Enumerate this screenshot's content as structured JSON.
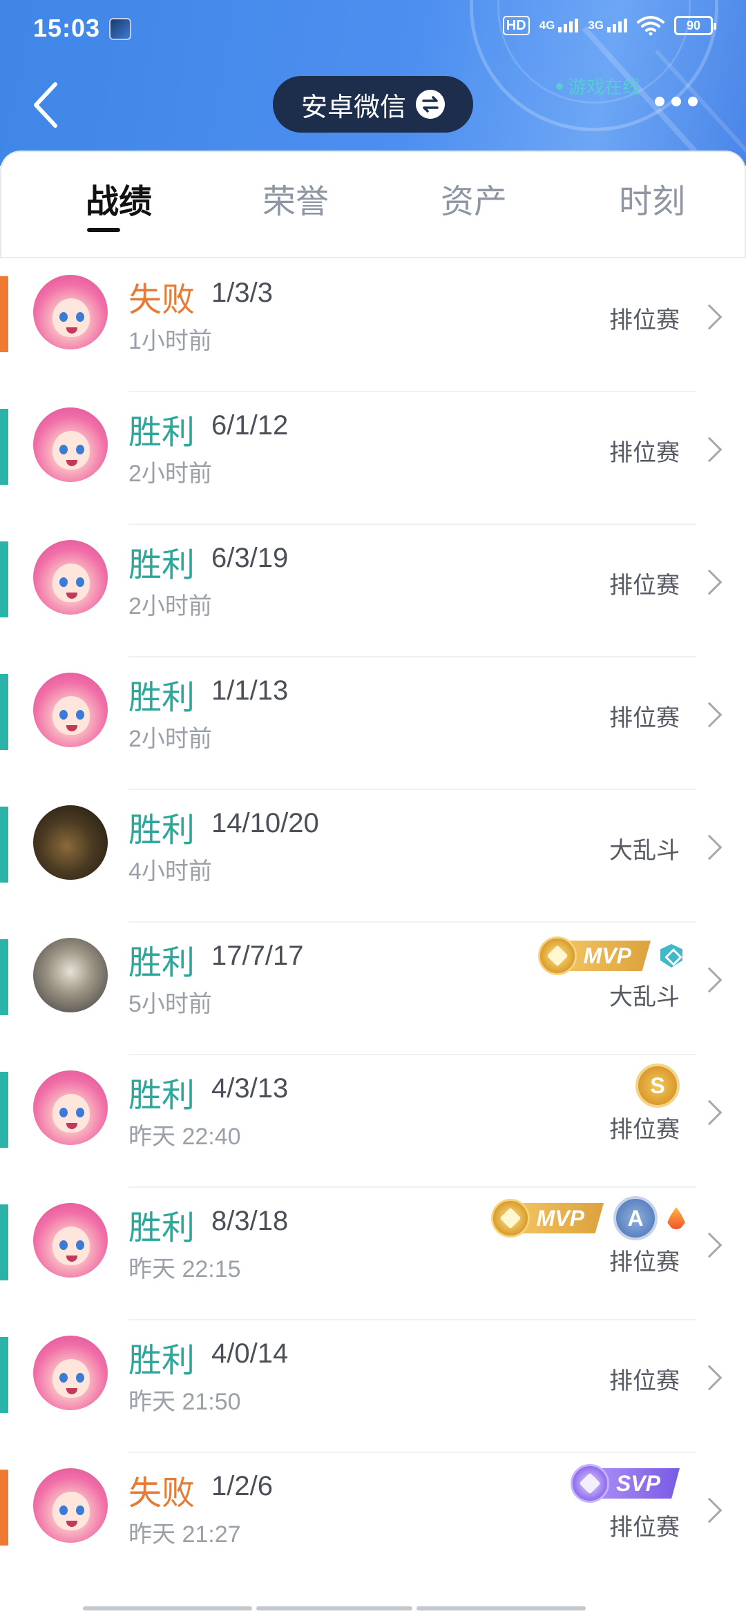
{
  "status_bar": {
    "time": "15:03",
    "hd": "HD",
    "net1": "4G",
    "net2": "3G",
    "battery": "90"
  },
  "header": {
    "account_label": "安卓微信",
    "online_status": "游戏在线",
    "colors": {
      "header_blue": "#4d8ff0",
      "account_pill": "#1c2e4c",
      "online_teal": "#4fd8c8"
    }
  },
  "tabs": [
    {
      "label": "战绩",
      "active": true
    },
    {
      "label": "荣誉",
      "active": false
    },
    {
      "label": "资产",
      "active": false
    },
    {
      "label": "时刻",
      "active": false
    }
  ],
  "colors": {
    "win": "#2aa89c",
    "lose": "#e57b36"
  },
  "matches": [
    {
      "result": "失败",
      "kda": "1/3/3",
      "time": "1小时前",
      "mode": "排位赛",
      "avatar": "pink-hero-avatar",
      "badges": []
    },
    {
      "result": "胜利",
      "kda": "6/1/12",
      "time": "2小时前",
      "mode": "排位赛",
      "avatar": "pink-hero-avatar",
      "badges": []
    },
    {
      "result": "胜利",
      "kda": "6/3/19",
      "time": "2小时前",
      "mode": "排位赛",
      "avatar": "pink-hero-avatar",
      "badges": []
    },
    {
      "result": "胜利",
      "kda": "1/1/13",
      "time": "2小时前",
      "mode": "排位赛",
      "avatar": "pink-hero-avatar",
      "badges": []
    },
    {
      "result": "胜利",
      "kda": "14/10/20",
      "time": "4小时前",
      "mode": "大乱斗",
      "avatar": "beast-hero-avatar",
      "badges": []
    },
    {
      "result": "胜利",
      "kda": "17/7/17",
      "time": "5小时前",
      "mode": "大乱斗",
      "avatar": "armored-hero-avatar",
      "badges": [
        "MVP",
        "shield"
      ]
    },
    {
      "result": "胜利",
      "kda": "4/3/13",
      "time": "昨天 22:40",
      "mode": "排位赛",
      "avatar": "pink-hero-avatar",
      "badges": [
        "S"
      ]
    },
    {
      "result": "胜利",
      "kda": "8/3/18",
      "time": "昨天 22:15",
      "mode": "排位赛",
      "avatar": "pink-hero-avatar",
      "badges": [
        "MVP",
        "A",
        "flame"
      ]
    },
    {
      "result": "胜利",
      "kda": "4/0/14",
      "time": "昨天 21:50",
      "mode": "排位赛",
      "avatar": "pink-hero-avatar",
      "badges": []
    },
    {
      "result": "失败",
      "kda": "1/2/6",
      "time": "昨天 21:27",
      "mode": "排位赛",
      "avatar": "pink-hero-avatar",
      "badges": [
        "SVP"
      ]
    }
  ]
}
